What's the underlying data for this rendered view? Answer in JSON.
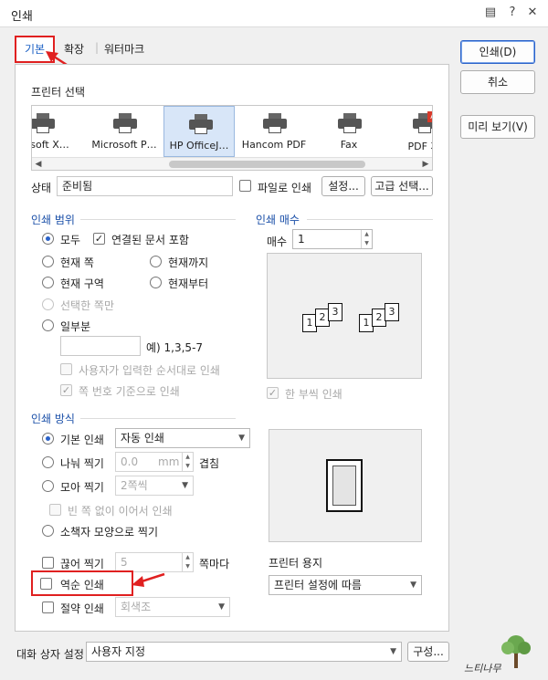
{
  "window": {
    "title": "인쇄",
    "title_buttons": [
      "message-icon",
      "help-icon",
      "close-icon"
    ]
  },
  "tabs": [
    {
      "label": "기본",
      "active": true
    },
    {
      "label": "확장",
      "active": false
    },
    {
      "label": "워터마크",
      "active": false
    }
  ],
  "printer_select": {
    "label": "프린터 선택",
    "printers": [
      {
        "name": "crosoft X…"
      },
      {
        "name": "Microsoft P…"
      },
      {
        "name": "HP OfficeJ…",
        "selected": true
      },
      {
        "name": "Hancom PDF"
      },
      {
        "name": "Fax"
      },
      {
        "name": "PDF 저"
      }
    ]
  },
  "status": {
    "label": "상태",
    "value": "준비됨",
    "file_print_label": "파일로 인쇄",
    "settings_button": "설정...",
    "advanced_button": "고급 선택..."
  },
  "print_range": {
    "title": "인쇄 범위",
    "all": "모두",
    "include_linked": "연결된 문서 포함",
    "current_page": "현재 쪽",
    "to_current": "현재까지",
    "current_section": "현재 구역",
    "from_current": "현재부터",
    "selected_pages": "선택한 쪽만",
    "partial": "일부분",
    "partial_example": "예) 1,3,5-7",
    "user_order": "사용자가 입력한 순서대로 인쇄",
    "page_number_basis": "쪽 번호 기준으로 인쇄"
  },
  "copies": {
    "title": "인쇄 매수",
    "label": "매수",
    "value": "1",
    "collate_label": "한 부씩 인쇄",
    "pages_a": [
      "1",
      "2",
      "3"
    ],
    "pages_b": [
      "1",
      "2",
      "3"
    ]
  },
  "print_method": {
    "title": "인쇄 방식",
    "basic": "기본 인쇄",
    "basic_option": "자동 인쇄",
    "split": "나눠 찍기",
    "split_value": "0.0",
    "split_unit": "mm",
    "split_suffix": "겹침",
    "gather": "모아 찍기",
    "gather_option": "2쪽씩",
    "no_blank": "빈 쪽 없이 이어서 인쇄",
    "booklet": "소책자 모양으로 찍기",
    "cut": "끊어 찍기",
    "cut_value": "5",
    "cut_suffix": "쪽마다",
    "reverse": "역순 인쇄",
    "economy": "절약 인쇄",
    "economy_option": "회색조"
  },
  "paper": {
    "label": "프린터 용지",
    "option": "프린터 설정에 따름"
  },
  "dialog_settings": {
    "label": "대화 상자 설정",
    "option": "사용자 지정",
    "config_button": "구성..."
  },
  "side_buttons": {
    "print": "인쇄(D)",
    "cancel": "취소",
    "preview": "미리 보기(V)"
  },
  "watermark_text": "느티나무"
}
